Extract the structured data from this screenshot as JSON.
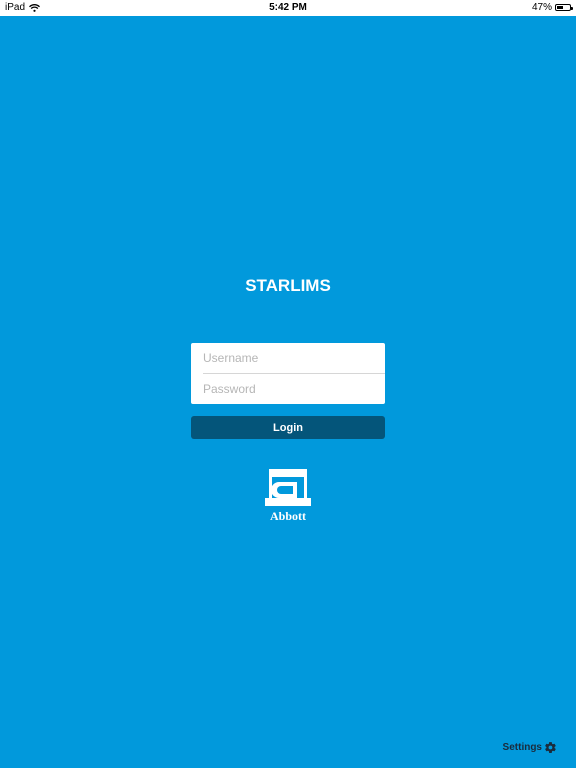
{
  "status_bar": {
    "device": "iPad",
    "time": "5:42 PM",
    "battery_percent": "47%",
    "battery_level": 0.47,
    "icons": [
      "wifi-icon",
      "battery-icon"
    ]
  },
  "app": {
    "title": "STARLIMS"
  },
  "login_form": {
    "username_value": "",
    "username_placeholder": "Username",
    "password_value": "",
    "password_placeholder": "Password",
    "login_label": "Login"
  },
  "brand": {
    "name": "Abbott"
  },
  "settings": {
    "label": "Settings",
    "icon": "gear-icon"
  },
  "colors": {
    "background": "#0199DC",
    "button": "#04557A",
    "text": "#FFFFFF",
    "settings_text": "#1A2B3C"
  }
}
